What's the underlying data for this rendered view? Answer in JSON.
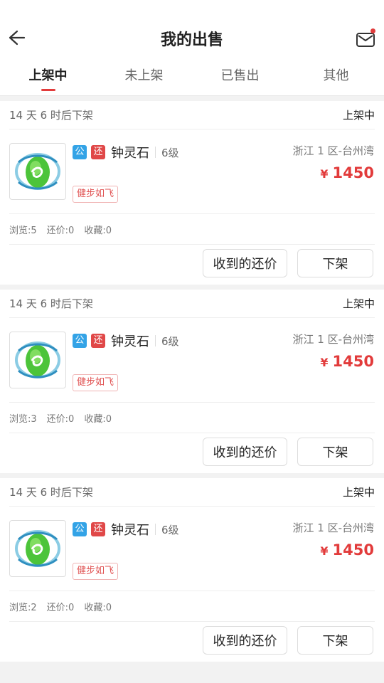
{
  "header": {
    "title": "我的出售"
  },
  "tabs": [
    {
      "label": "上架中",
      "active": true
    },
    {
      "label": "未上架",
      "active": false
    },
    {
      "label": "已售出",
      "active": false
    },
    {
      "label": "其他",
      "active": false
    }
  ],
  "colors": {
    "accent": "#e23b3b",
    "tag_gong": "#33a3e6",
    "tag_huan": "#e04848"
  },
  "listings": [
    {
      "expire": "14 天 6 时后下架",
      "status": "上架中",
      "icon": "green-spirit-stone-icon",
      "tag_gong": "公",
      "tag_huan": "还",
      "name": "钟灵石",
      "level": "6级",
      "server": "浙江 1 区-台州湾",
      "currency": "¥",
      "price": "1450",
      "skill": "健步如飞",
      "views": "浏览:5",
      "counter_offers": "还价:0",
      "favorites": "收藏:0",
      "offers_button": "收到的还价",
      "delist_button": "下架"
    },
    {
      "expire": "14 天 6 时后下架",
      "status": "上架中",
      "icon": "green-spirit-stone-icon",
      "tag_gong": "公",
      "tag_huan": "还",
      "name": "钟灵石",
      "level": "6级",
      "server": "浙江 1 区-台州湾",
      "currency": "¥",
      "price": "1450",
      "skill": "健步如飞",
      "views": "浏览:3",
      "counter_offers": "还价:0",
      "favorites": "收藏:0",
      "offers_button": "收到的还价",
      "delist_button": "下架"
    },
    {
      "expire": "14 天 6 时后下架",
      "status": "上架中",
      "icon": "green-spirit-stone-icon",
      "tag_gong": "公",
      "tag_huan": "还",
      "name": "钟灵石",
      "level": "6级",
      "server": "浙江 1 区-台州湾",
      "currency": "¥",
      "price": "1450",
      "skill": "健步如飞",
      "views": "浏览:2",
      "counter_offers": "还价:0",
      "favorites": "收藏:0",
      "offers_button": "收到的还价",
      "delist_button": "下架"
    }
  ]
}
